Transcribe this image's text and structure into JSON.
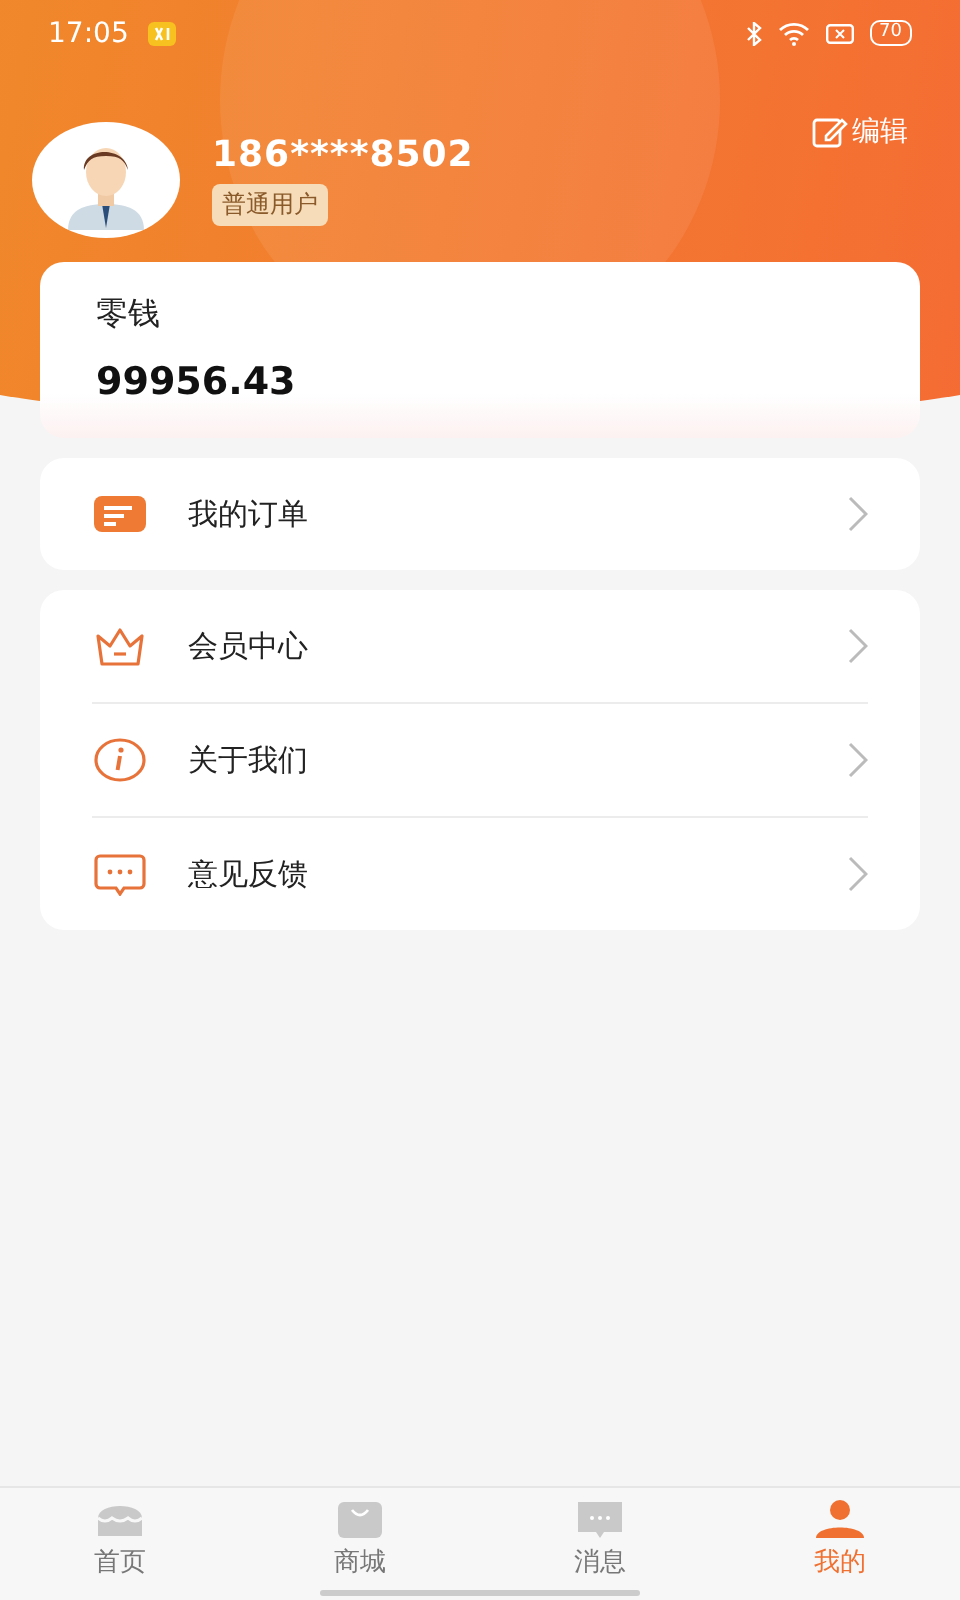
{
  "status_bar": {
    "time": "17:05",
    "battery": "70"
  },
  "profile": {
    "phone": "186****8502",
    "level": "普通用户",
    "edit": "编辑"
  },
  "wallet": {
    "label": "零钱",
    "amount": "99956.43"
  },
  "menu_groups": [
    [
      {
        "kind": "order",
        "label": "我的订单"
      }
    ],
    [
      {
        "kind": "vip",
        "label": "会员中心"
      },
      {
        "kind": "info",
        "label": "关于我们"
      },
      {
        "kind": "feedback",
        "label": "意见反馈"
      }
    ]
  ],
  "tabs": [
    {
      "kind": "home",
      "label": "首页",
      "selected": false
    },
    {
      "kind": "shop",
      "label": "商城",
      "selected": false
    },
    {
      "kind": "message",
      "label": "消息",
      "selected": false
    },
    {
      "kind": "me",
      "label": "我的",
      "selected": true
    }
  ]
}
